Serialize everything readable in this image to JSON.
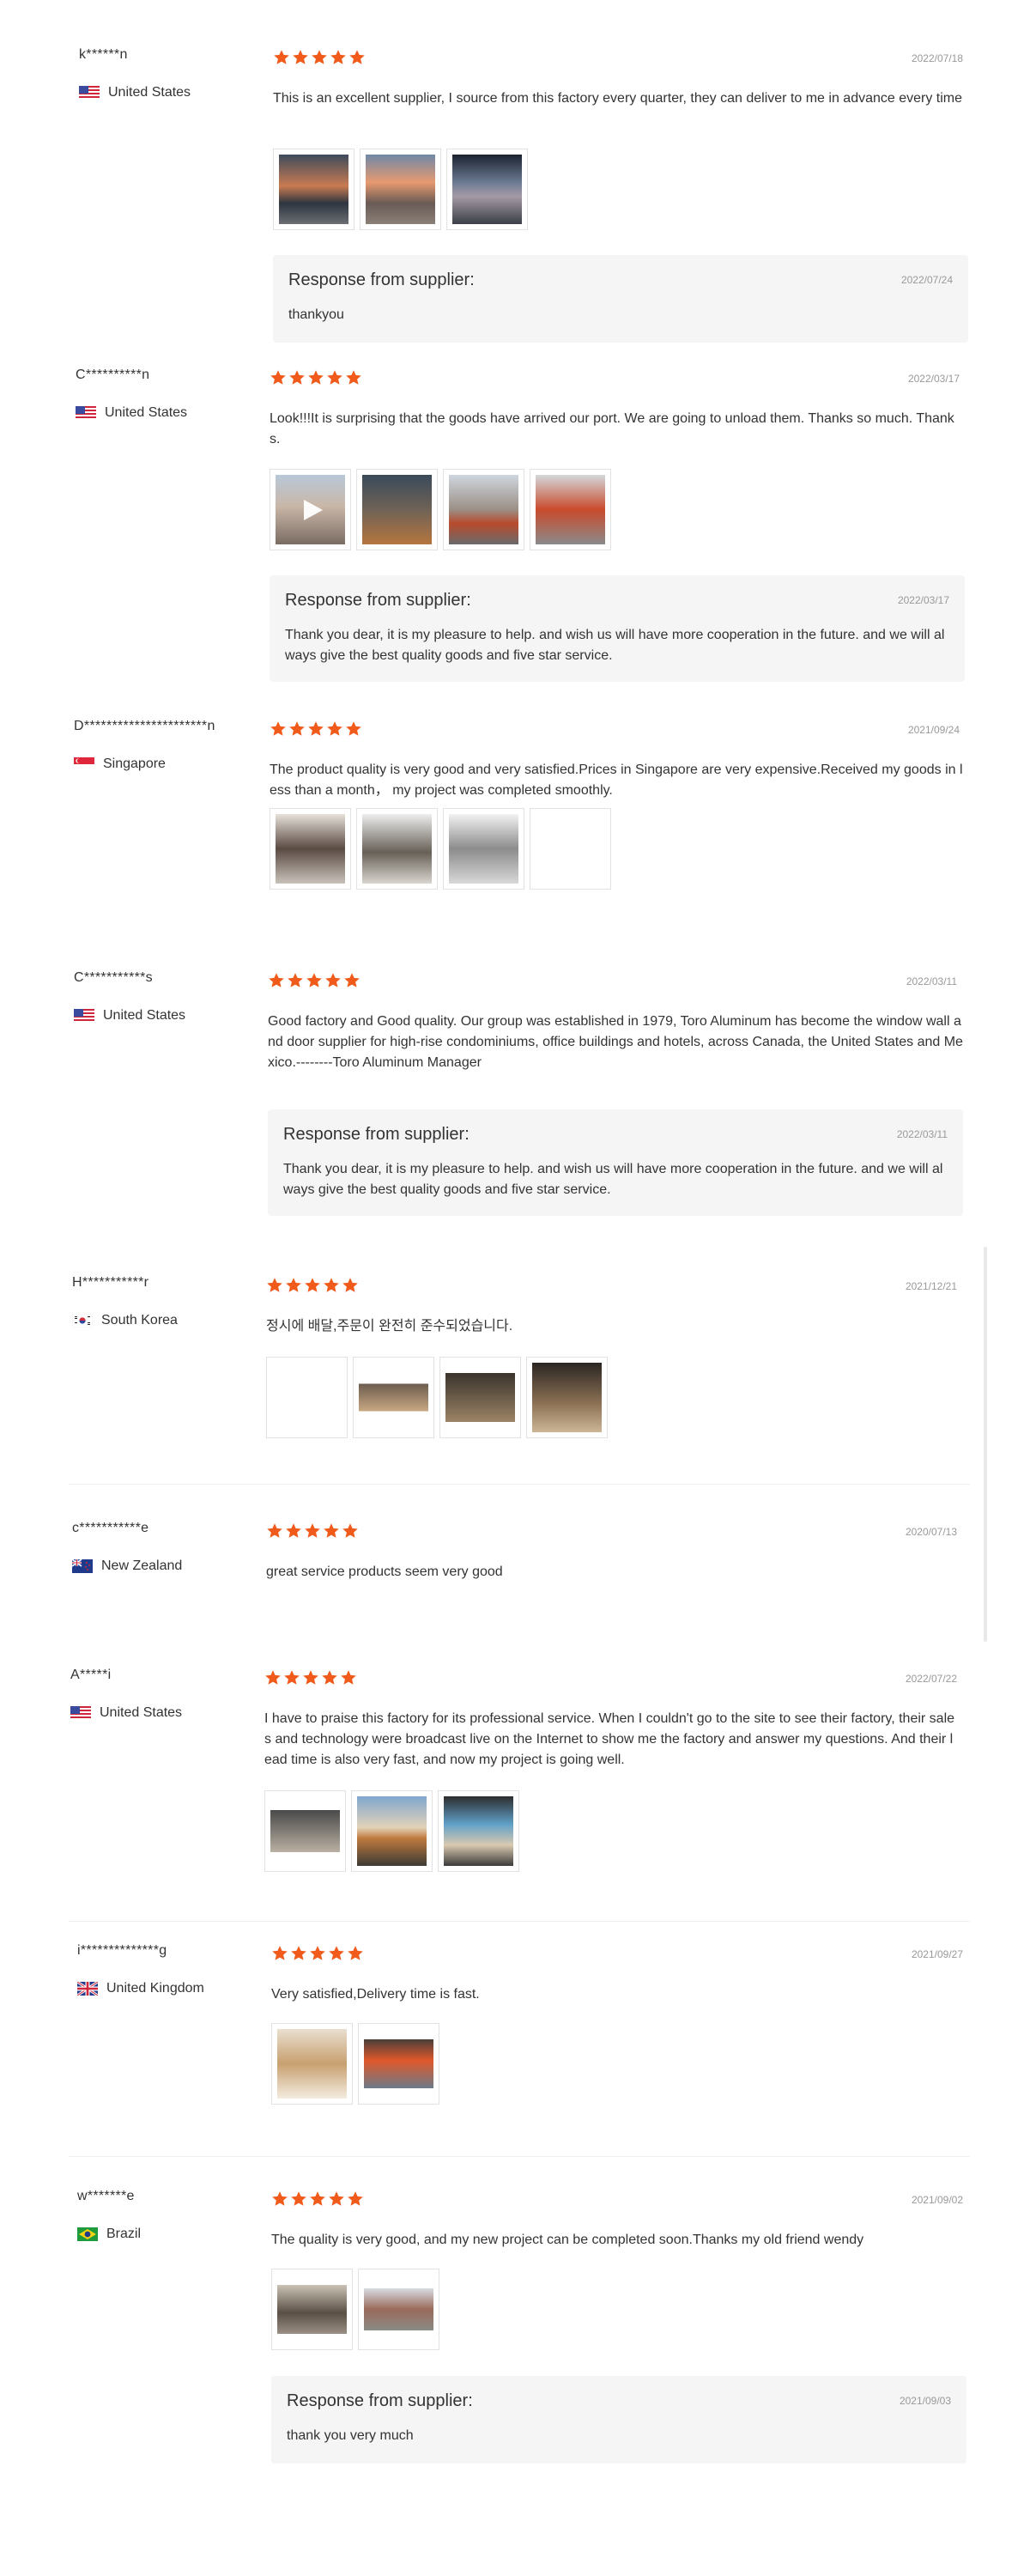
{
  "response_title": "Response from supplier:",
  "colors": {
    "star": "#f05a1a",
    "response_bg": "#f5f5f5",
    "date": "#999999"
  },
  "reviews": [
    {
      "buyer": "k******n",
      "country": "United States",
      "flag": "flag-us-icon",
      "rating": 5,
      "date": "2022/07/18",
      "text": "This is an excellent supplier, I source from this factory every quarter, they can deliver to me in advance every time",
      "images": [
        "photo",
        "photo",
        "photo"
      ],
      "response": {
        "date": "2022/07/24",
        "text": "thankyou"
      }
    },
    {
      "buyer": "C**********n",
      "country": "United States",
      "flag": "flag-us-icon",
      "rating": 5,
      "date": "2022/03/17",
      "text": "Look!!!It is surprising that the goods have arrived our port. We are going to unload them. Thanks so much. Thanks.",
      "images": [
        "video",
        "photo",
        "photo",
        "photo"
      ],
      "response": {
        "date": "2022/03/17",
        "text": "Thank you dear, it is my pleasure to help. and wish us will have more cooperation in the future. and we will always give the best quality goods and five star service."
      }
    },
    {
      "buyer": "D**********************n",
      "country": "Singapore",
      "flag": "flag-sg-icon",
      "rating": 5,
      "date": "2021/09/24",
      "text": "The product quality is very good and very satisfied.Prices in Singapore are very expensive.Received my goods in less than a month， my project was completed smoothly.",
      "images": [
        "photo",
        "photo",
        "photo",
        "blank"
      ],
      "response": null
    },
    {
      "buyer": "C***********s",
      "country": "United States",
      "flag": "flag-us-icon",
      "rating": 5,
      "date": "2022/03/11",
      "text": "Good factory and Good quality. Our group was established in 1979, Toro Aluminum has become the window wall and door supplier for high-rise condominiums, office buildings and hotels, across Canada, the United States and Mexico.--------Toro Aluminum Manager",
      "images": [],
      "response": {
        "date": "2022/03/11",
        "text": "Thank you dear, it is my pleasure to help. and wish us will have more cooperation in the future. and we will always give the best quality goods and five star service."
      }
    },
    {
      "buyer": "H***********r",
      "country": "South Korea",
      "flag": "flag-kr-icon",
      "rating": 5,
      "date": "2021/12/21",
      "text": "정시에 배달,주문이 완전히 준수되었습니다.",
      "images": [
        "blank",
        "photo",
        "photo",
        "photo"
      ],
      "response": null
    },
    {
      "buyer": "c***********e",
      "country": "New Zealand",
      "flag": "flag-nz-icon",
      "rating": 5,
      "date": "2020/07/13",
      "text": "great service products seem very good",
      "images": [],
      "response": null
    },
    {
      "buyer": "A*****i",
      "country": "United States",
      "flag": "flag-us-icon",
      "rating": 5,
      "date": "2022/07/22",
      "text": "I have to praise this factory for its professional service. When I couldn't go to the site to see their factory, their sales and technology were broadcast live on the Internet to show me the factory and answer my questions. And their lead time is also very fast, and now my project is going well.",
      "images": [
        "photo",
        "photo",
        "photo"
      ],
      "response": null
    },
    {
      "buyer": "i**************g",
      "country": "United Kingdom",
      "flag": "flag-gb-icon",
      "rating": 5,
      "date": "2021/09/27",
      "text": "Very satisfied,Delivery time is fast.",
      "images": [
        "photo",
        "photo"
      ],
      "response": null
    },
    {
      "buyer": "w*******e",
      "country": "Brazil",
      "flag": "flag-br-icon",
      "rating": 5,
      "date": "2021/09/02",
      "text": "The quality is very good, and my new project can be completed soon.Thanks my old friend wendy",
      "images": [
        "photo",
        "photo"
      ],
      "response": {
        "date": "2021/09/03",
        "text": "thank you very much"
      }
    }
  ]
}
